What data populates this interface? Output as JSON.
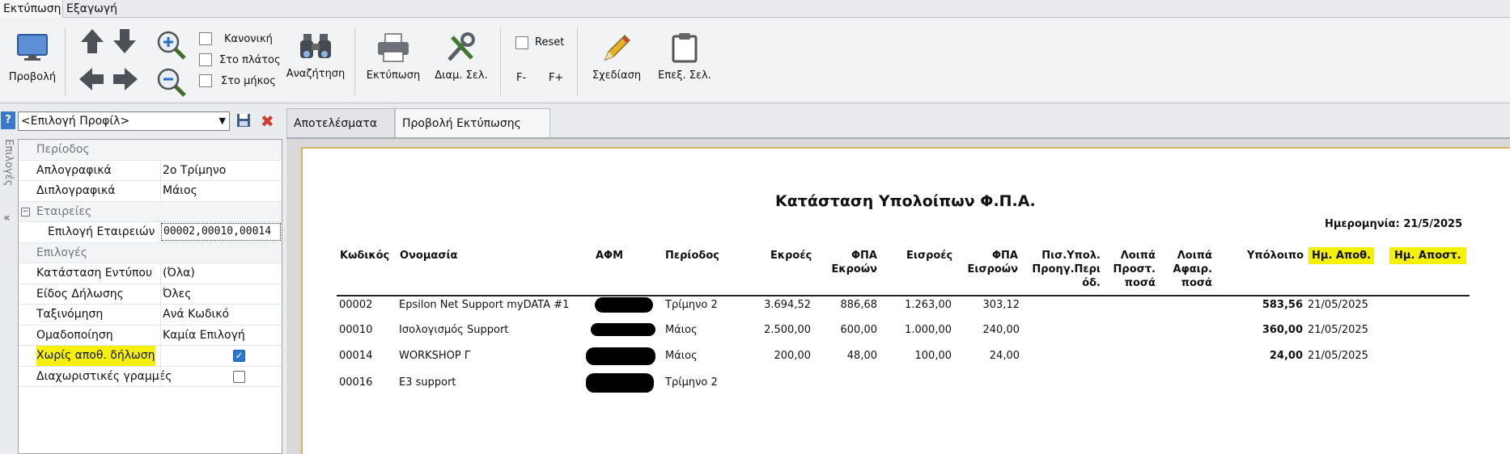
{
  "ribbon": {
    "tabs": [
      "Εκτύπωση",
      "Εξαγωγή"
    ],
    "buttons": {
      "view": "Προβολή",
      "zoom_normal": "Κανονική",
      "zoom_width": "Στο πλάτος",
      "zoom_length": "Στο μήκος",
      "search": "Αναζήτηση",
      "print": "Εκτύπωση",
      "page_setup": "Διαμ. Σελ.",
      "reset": "Reset",
      "f_minus": "F-",
      "f_plus": "F+",
      "design": "Σχεδίαση",
      "edit_page": "Επεξ. Σελ."
    }
  },
  "left_panel": {
    "help": "?",
    "side_label": "Επιλογές",
    "collapse_chevron": "«",
    "profile_select": "<Επιλογή Προφίλ>",
    "rows": [
      {
        "type": "category",
        "label": "Περίοδος"
      },
      {
        "label": "Απλογραφικά",
        "value": "2ο Τρίμηνο"
      },
      {
        "label": "Διπλογραφικά",
        "value": "Μάιος"
      },
      {
        "type": "category",
        "label": "Εταιρείες"
      },
      {
        "label": "Επιλογή Εταιρειών",
        "value": "00002,00010,00014"
      },
      {
        "type": "category",
        "label": "Επιλογές"
      },
      {
        "label": "Κατάσταση Εντύπου",
        "value": "(Όλα)"
      },
      {
        "label": "Είδος Δήλωσης",
        "value": "Όλες"
      },
      {
        "label": "Ταξινόμηση",
        "value": "Ανά Κωδικό"
      },
      {
        "label": "Ομαδοποίηση",
        "value": "Καμία Επιλογή"
      },
      {
        "label": "Χωρίς αποθ. δήλωση",
        "checked": true
      },
      {
        "label": "Διαχωριστικές γραμμές",
        "checked": false
      }
    ]
  },
  "content_tabs": [
    "Αποτελέσματα",
    "Προβολή Εκτύπωσης"
  ],
  "report": {
    "title": "Κατάσταση Υπολοίπων Φ.Π.Α.",
    "date": "Ημερομηνία: 21/5/2025",
    "columns": {
      "code": "Κωδικός",
      "name": "Ονομασία",
      "afm": "ΑΦΜ",
      "period": "Περίοδος",
      "outflows": "Εκροές",
      "vat_out_1": "ΦΠΑ",
      "vat_out_2": "Εκροών",
      "inflows": "Εισροές",
      "vat_in_1": "ΦΠΑ",
      "vat_in_2": "Εισροών",
      "credit_1": "Πισ.Υπολ.",
      "credit_2": "Προηγ.Περι",
      "credit_3": "όδ.",
      "other_add_1": "Λοιπά",
      "other_add_2": "Προστ.",
      "other_add_3": "ποσά",
      "other_sub_1": "Λοιπά",
      "other_sub_2": "Αφαιρ.",
      "other_sub_3": "ποσά",
      "balance": "Υπόλοιπο",
      "saved_date": "Ημ. Αποθ.",
      "sent_date": "Ημ. Αποστ."
    },
    "rows": [
      {
        "code": "00002",
        "name": "Epsilon Net Support myDATA #1",
        "period": "Τρίμηνο 2",
        "outflows": "3.694,52",
        "vat_out": "886,68",
        "inflows": "1.263,00",
        "vat_in": "303,12",
        "balance": "583,56",
        "saved": "21/05/2025"
      },
      {
        "code": "00010",
        "name": "Ισολογισμός Support",
        "period": "Μάιος",
        "outflows": "2.500,00",
        "vat_out": "600,00",
        "inflows": "1.000,00",
        "vat_in": "240,00",
        "balance": "360,00",
        "saved": "21/05/2025"
      },
      {
        "code": "00014",
        "name": "WORKSHOP Γ",
        "period": "Μάιος",
        "outflows": "200,00",
        "vat_out": "48,00",
        "inflows": "100,00",
        "vat_in": "24,00",
        "balance": "24,00",
        "saved": "21/05/2025"
      },
      {
        "code": "00016",
        "name": "E3 support",
        "period": "Τρίμηνο 2",
        "outflows": "",
        "vat_out": "",
        "inflows": "",
        "vat_in": "",
        "balance": "",
        "saved": ""
      }
    ]
  },
  "colors": {
    "highlight": "#f4f00b",
    "accent": "#2a76d2",
    "page_border": "#d5b260"
  }
}
